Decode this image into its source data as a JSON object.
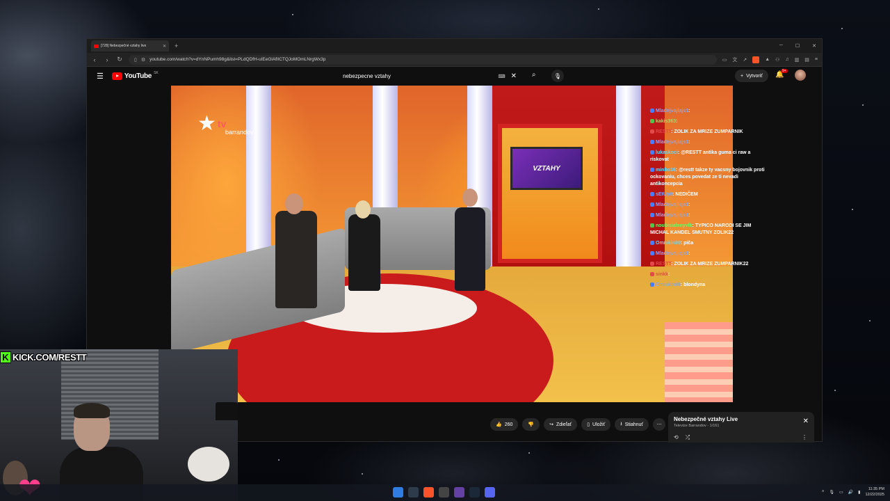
{
  "browser": {
    "tab_title": "[728] Nebezpečné vztahy live",
    "url": "youtube.com/watch?v=dYnNPumh98g&list=PLdQDfH-uIEeGlAflICTQJoMOmLNrgWx3p"
  },
  "youtube": {
    "logo_text": "YouTube",
    "country_code": "SK",
    "search_value": "nebezpecne vztahy",
    "create_label": "Vytvoriť",
    "notification_count": "9+"
  },
  "video": {
    "channel_logo_tv": "tv",
    "channel_logo_name": "barrandov",
    "studio_screen_text": "VZTAHY"
  },
  "chat": [
    {
      "user": "Mladejvajlajs1",
      "color": "u-b",
      "text": ""
    },
    {
      "user": "kakis363",
      "color": "u-g",
      "text": ""
    },
    {
      "user": "RESTT",
      "color": "u-r",
      "text": "ZOLIK ZA MRIZE ZUMPARNIK"
    },
    {
      "user": "Mladejvajlajs1",
      "color": "u-b",
      "text": ""
    },
    {
      "user": "lukaskoci",
      "color": "u-c",
      "text": "@RESTT antika guma ci raw a riskovat"
    },
    {
      "user": "minho16",
      "color": "u-c",
      "text": "@restt takze ty vacsny bojovnik proti ockovaniu, chces povedat ze ti nevadi antikoncepcia"
    },
    {
      "user": "sEtUp9",
      "color": "u-b",
      "text": "NEDIČEM"
    },
    {
      "user": "Mladejvajlajs1",
      "color": "u-b",
      "text": ""
    },
    {
      "user": "Mladejvajlajs1",
      "color": "u-b",
      "text": ""
    },
    {
      "user": "noubisialenyvlk",
      "color": "u-g",
      "text": "TYPICO NARODI SE JIM MICHAL KANDEL SMUTNY ZOLIK22"
    },
    {
      "user": "Omnikin99",
      "color": "u-c",
      "text": "piča"
    },
    {
      "user": "Mladejvajlajs1",
      "color": "u-b",
      "text": ""
    },
    {
      "user": "RESTT",
      "color": "u-r",
      "text": "ZOLIK ZA MRIZE ZUMPARNIK22"
    },
    {
      "user": "sinkk",
      "color": "u-r",
      "text": ""
    },
    {
      "user": "Omnikin99",
      "color": "u-b",
      "text": "blondyna"
    }
  ],
  "actions": {
    "like_count": "260",
    "share_label": "Zdieľať",
    "save_label": "Uložiť",
    "download_label": "Stiahnuť"
  },
  "mini_player": {
    "title": "Nebezpečné vztahy Live",
    "subtitle": "Televize Barrandov - 1/161"
  },
  "overlay": {
    "kick_text": "KICK.COM/RESTT"
  },
  "taskbar": {
    "time": "11:35 PM",
    "date": "12/22/2025"
  },
  "colors": {
    "youtube_red": "#ff0000",
    "kick_green": "#53fc18",
    "chat_mod_red": "#e34a4a"
  }
}
